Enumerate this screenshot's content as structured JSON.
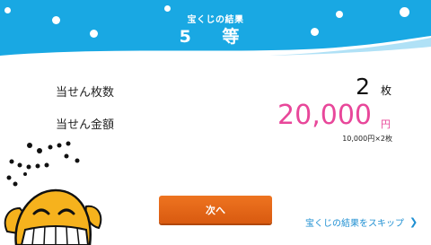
{
  "header": {
    "title": "宝くじの結果",
    "rank": "5 等"
  },
  "result": {
    "count_label": "当せん枚数",
    "count_value": "2",
    "count_unit": "枚",
    "amount_label": "当せん金額",
    "amount_value": "20,000",
    "amount_unit": "円",
    "breakdown": "10,000円×2枚"
  },
  "actions": {
    "next_label": "次へ",
    "skip_label": "宝くじの結果をスキップ"
  },
  "colors": {
    "header": "#19a8e3",
    "amount": "#e8479a",
    "button": "#e9691b",
    "link": "#1e8fd2"
  }
}
